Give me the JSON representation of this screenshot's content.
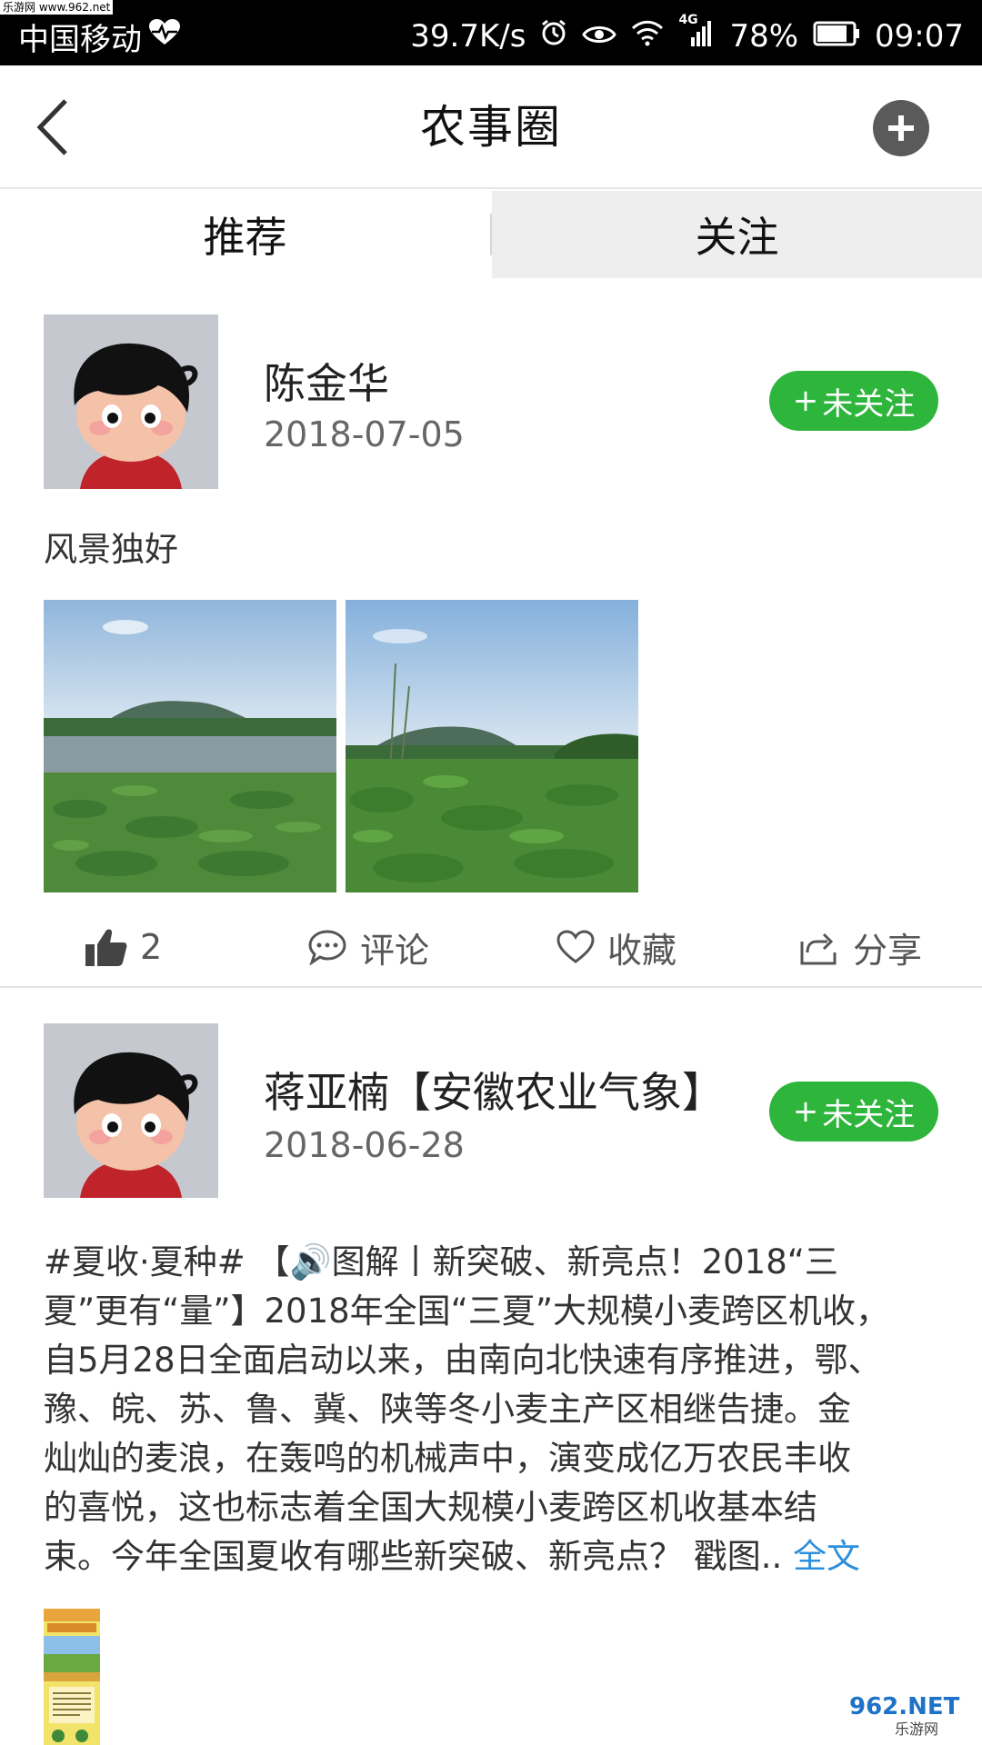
{
  "watermark": "乐游网 www.962.net",
  "status_bar": {
    "carrier": "中国移动",
    "speed": "39.7K/s",
    "network": "4G",
    "battery": "78%",
    "time": "09:07"
  },
  "header": {
    "title": "农事圈"
  },
  "tabs": [
    {
      "label": "推荐",
      "active": true
    },
    {
      "label": "关注",
      "active": false
    }
  ],
  "posts": [
    {
      "author": "陈金华",
      "date": "2018-07-05",
      "follow_label": "未关注",
      "text": "风景独好",
      "actions": {
        "like_count": "2",
        "comment_label": "评论",
        "favorite_label": "收藏",
        "share_label": "分享"
      }
    },
    {
      "author": "蒋亚楠【安徽农业气象】",
      "date": "2018-06-28",
      "follow_label": "未关注",
      "text_lines": [
        "#夏收·夏种# 【🔊图解丨新突破、新亮点！2018“三",
        "夏”更有“量”】2018年全国“三夏”大规模小麦跨区机收，",
        "自5月28日全面启动以来，由南向北快速有序推进，鄂、",
        "豫、皖、苏、鲁、冀、陕等冬小麦主产区相继告捷。金",
        "灿灿的麦浪，在轰鸣的机械声中，演变成亿万农民丰收",
        "的喜悦，这也标志着全国大规模小麦跨区机收基本结"
      ],
      "last_line": "束。今年全国夏收有哪些新突破、新亮点？ 戳图..",
      "full_text_link": "全文"
    }
  ],
  "site_logo": {
    "main": "962.NET",
    "sub": "乐游网"
  },
  "colors": {
    "follow_green": "#2eb53c",
    "link_blue": "#2b8fdc"
  }
}
